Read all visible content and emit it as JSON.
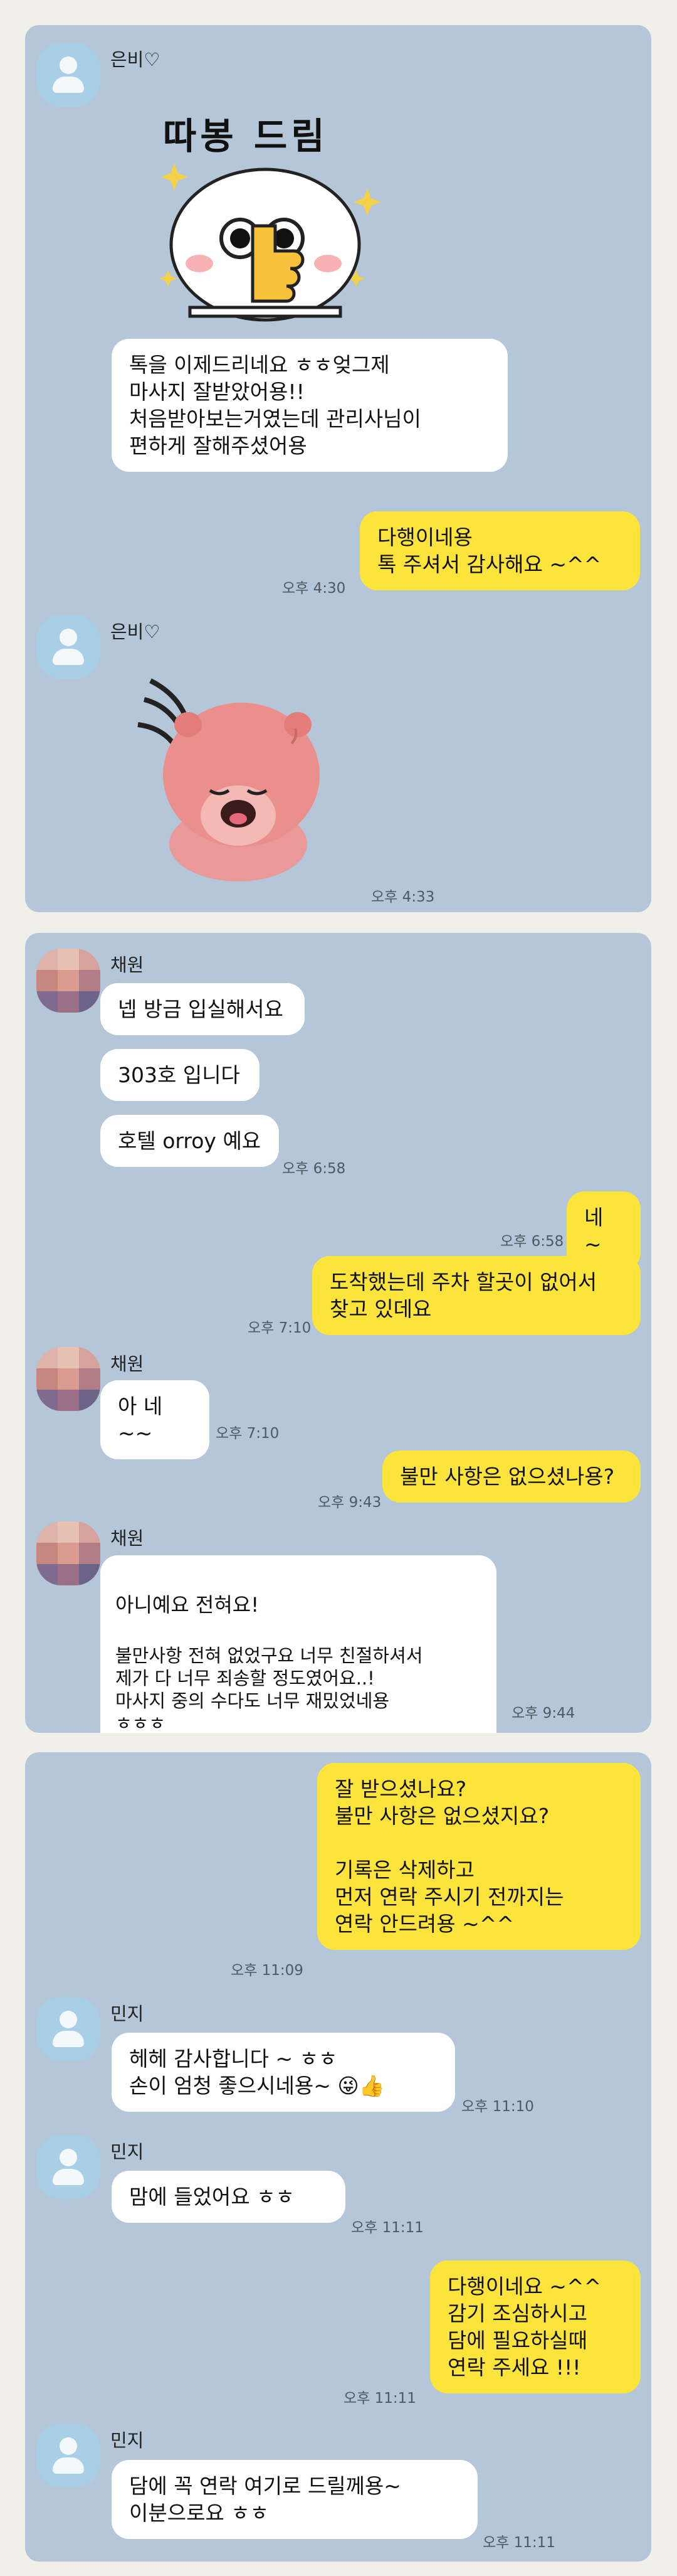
{
  "chat1": {
    "sender": "은비♡",
    "sticker_caption": "따봉 드림",
    "msg1": "톡을 이제드리네요 ㅎㅎ엊그제\n마사지 잘받았어용!!\n처음받아보는거였는데 관리사님이\n편하게 잘해주셨어용",
    "reply": "다행이네용\n톡 주셔서 감사해요 ~^^",
    "reply_time": "오후 4:30",
    "sender2": "은비♡",
    "sticker_time": "오후 4:33"
  },
  "chat2": {
    "sender": "채원",
    "m1": "넵 방금 입실해서요",
    "m2": "303호 입니다",
    "m3": "호텔 orroy 예요",
    "m3_time": "오후 6:58",
    "r1": "네 ~",
    "r1_time": "오후 6:58",
    "r2": "도착했는데  주차 할곳이 없어서\n찾고 있데요",
    "r2_time": "오후 7:10",
    "sender2": "채원",
    "m4": "아 네~~",
    "m4_time": "오후 7:10",
    "r3": "불만 사항은 없으셨나용?",
    "r3_time": "오후 9:43",
    "sender3": "채원",
    "m5_line1": "아니예요 전혀요!",
    "m5_small": "불만사항 전혀 없었구요 너무 친절하셔서\n제가 다 너무 죄송할 정도였어요..!\n마사지 중의 수다도 너무 재밌었네용\nㅎㅎㅎ",
    "m5_time": "오후 9:44"
  },
  "chat3": {
    "r1": "잘 받으셨나요?\n불만 사항은 없으셨지요?\n\n기록은 삭제하고\n먼저 연락 주시기 전까지는\n연락 안드려용 ~^^",
    "r1_time": "오후 11:09",
    "sender1": "민지",
    "m1": "헤헤 감사합니다 ~ ㅎㅎ\n손이 엄청 좋으시네용~ 😜👍",
    "m1_time": "오후 11:10",
    "sender2": "민지",
    "m2": "맘에 들었어요 ㅎㅎ",
    "m2_time": "오후 11:11",
    "r2": "다행이네요 ~^^\n감기 조심하시고\n담에 필요하실때\n연락 주세요 !!!",
    "r2_time": "오후 11:11",
    "sender3": "민지",
    "m3": "담에 꼭 연락 여기로 드릴께용~\n이분으로요 ㅎㅎ",
    "m3_time": "오후 11:11"
  },
  "colors": {
    "background": "#f1efea",
    "chat_bg": "#b5c6d8",
    "my_bubble": "#fde43a",
    "their_bubble": "#ffffff",
    "avatar": "#a9cfe6"
  }
}
